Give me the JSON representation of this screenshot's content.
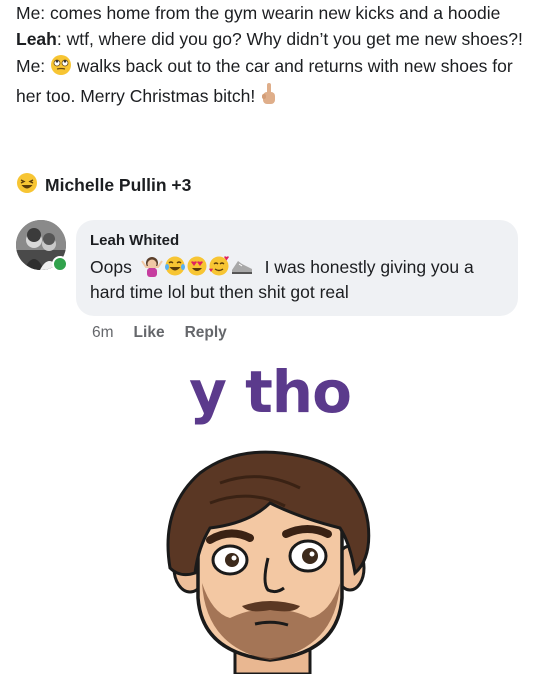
{
  "post": {
    "line1": "Me: comes home from the gym wearin new kicks and a hoodie",
    "line2_speaker": "Leah",
    "line2_text": ": wtf, where did you go? Why didn’t you get me new shoes?!",
    "line3_prefix": "Me:",
    "line3_text": "walks back out to the car and returns with new shoes for her too. Merry Christmas bitch!"
  },
  "reactions": {
    "text": "Michelle Pullin +3",
    "icon": "laughing-emoji-icon"
  },
  "comment": {
    "author": "Leah Whited",
    "text_before": "Oops",
    "text_after": "I was honestly giving you a hard time lol but then shit got real",
    "time": "6m",
    "like_label": "Like",
    "reply_label": "Reply",
    "online_color": "#31a24c"
  },
  "sticker": {
    "caption": "y tho",
    "caption_color": "#5b3a8c"
  }
}
